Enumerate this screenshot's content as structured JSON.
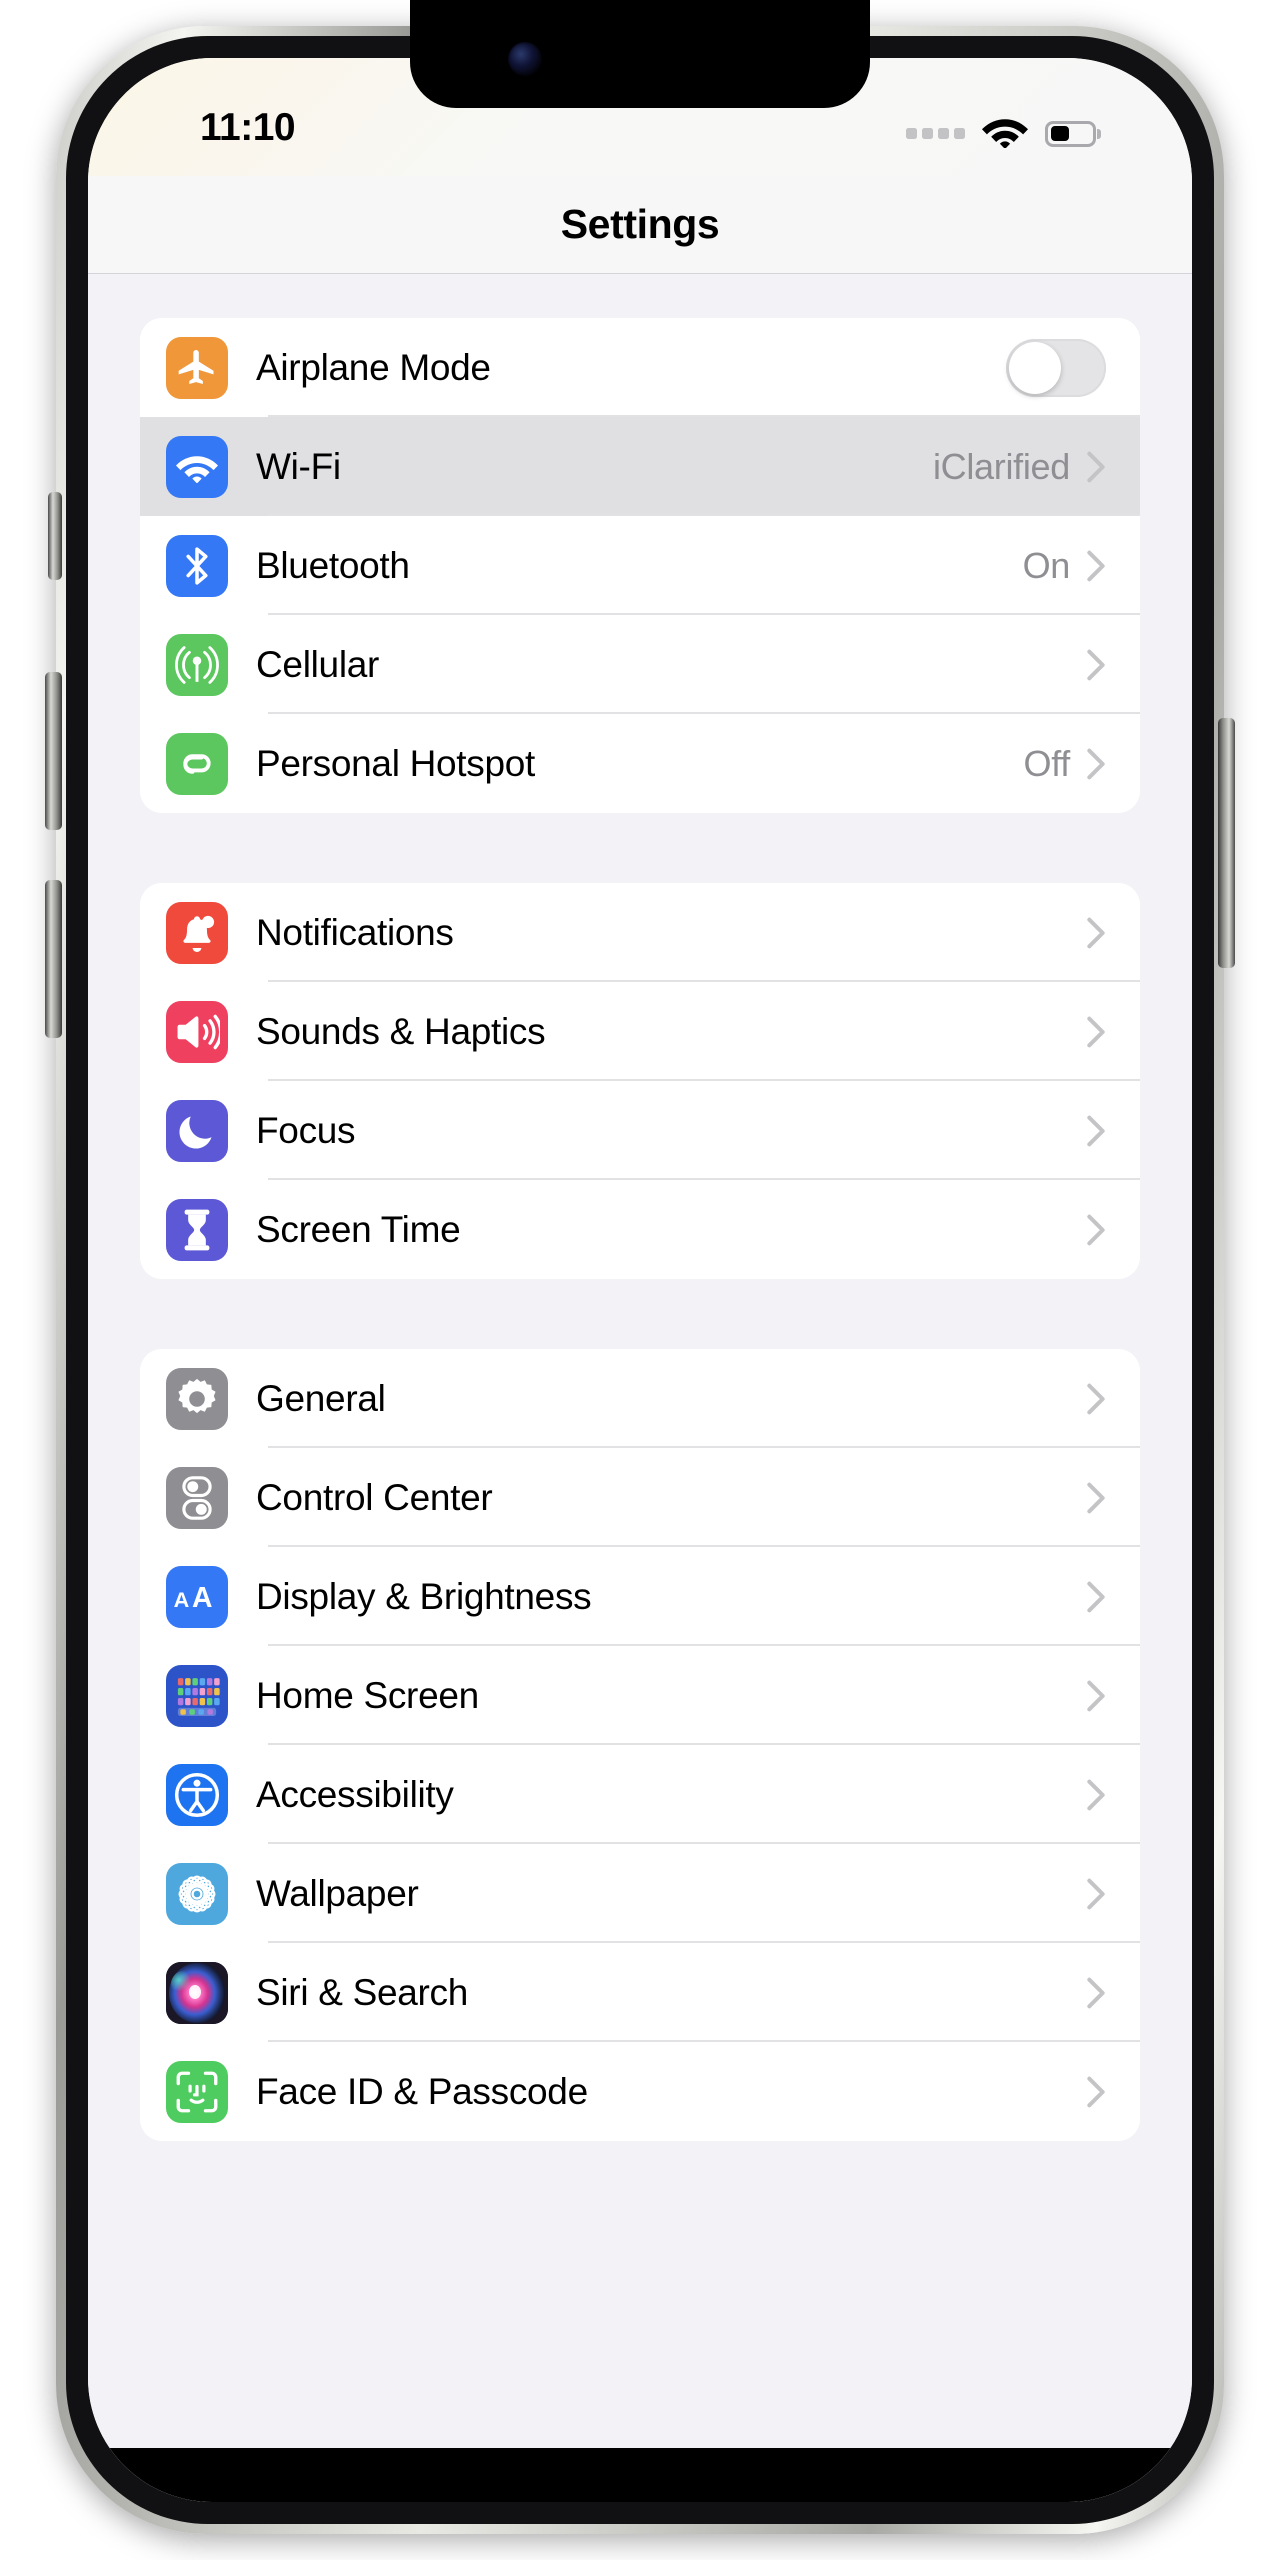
{
  "status_bar": {
    "time": "11:10",
    "cellular_icon": "cellular-dots-icon",
    "wifi_icon": "wifi-icon",
    "battery_icon": "battery-icon",
    "battery_level_percent": 45
  },
  "nav": {
    "title": "Settings"
  },
  "colors": {
    "airplane": "#ef9739",
    "wifi": "#3478f6",
    "bluetooth": "#3478f6",
    "cellular": "#5bc75e",
    "hotspot": "#5bc75e",
    "notifications": "#ef4a3c",
    "sounds": "#ef4060",
    "focus": "#5c58d6",
    "screentime": "#5c58d6",
    "general": "#8e8e93",
    "controlcenter": "#8e8e93",
    "display": "#3478f6",
    "homescreen": "#2c54c8",
    "accessibility": "#1e74f0",
    "wallpaper": "#4fa8dd",
    "siri": "#231f30",
    "faceid": "#4fcc5f",
    "selected_row_bg": "#e0e0e3",
    "value_text": "#8e8e93",
    "chevron": "#c4c4c6"
  },
  "groups": [
    {
      "id": "connectivity",
      "rows": [
        {
          "label": "Airplane Mode",
          "icon": "airplane-icon",
          "accessory": "toggle",
          "toggle_on": false,
          "value": ""
        },
        {
          "label": "Wi-Fi",
          "icon": "wifi-icon",
          "accessory": "chevron",
          "value": "iClarified",
          "selected": true
        },
        {
          "label": "Bluetooth",
          "icon": "bluetooth-icon",
          "accessory": "chevron",
          "value": "On"
        },
        {
          "label": "Cellular",
          "icon": "cellular-icon",
          "accessory": "chevron",
          "value": ""
        },
        {
          "label": "Personal Hotspot",
          "icon": "hotspot-icon",
          "accessory": "chevron",
          "value": "Off"
        }
      ]
    },
    {
      "id": "alerts",
      "rows": [
        {
          "label": "Notifications",
          "icon": "bell-icon",
          "accessory": "chevron",
          "value": ""
        },
        {
          "label": "Sounds & Haptics",
          "icon": "speaker-icon",
          "accessory": "chevron",
          "value": ""
        },
        {
          "label": "Focus",
          "icon": "moon-icon",
          "accessory": "chevron",
          "value": ""
        },
        {
          "label": "Screen Time",
          "icon": "hourglass-icon",
          "accessory": "chevron",
          "value": ""
        }
      ]
    },
    {
      "id": "system",
      "rows": [
        {
          "label": "General",
          "icon": "gear-icon",
          "accessory": "chevron",
          "value": ""
        },
        {
          "label": "Control Center",
          "icon": "control-center-icon",
          "accessory": "chevron",
          "value": ""
        },
        {
          "label": "Display & Brightness",
          "icon": "text-size-icon",
          "accessory": "chevron",
          "value": ""
        },
        {
          "label": "Home Screen",
          "icon": "app-grid-icon",
          "accessory": "chevron",
          "value": ""
        },
        {
          "label": "Accessibility",
          "icon": "accessibility-icon",
          "accessory": "chevron",
          "value": ""
        },
        {
          "label": "Wallpaper",
          "icon": "flower-icon",
          "accessory": "chevron",
          "value": ""
        },
        {
          "label": "Siri & Search",
          "icon": "siri-orb-icon",
          "accessory": "chevron",
          "value": ""
        },
        {
          "label": "Face ID & Passcode",
          "icon": "face-id-icon",
          "accessory": "chevron",
          "value": ""
        }
      ]
    }
  ]
}
